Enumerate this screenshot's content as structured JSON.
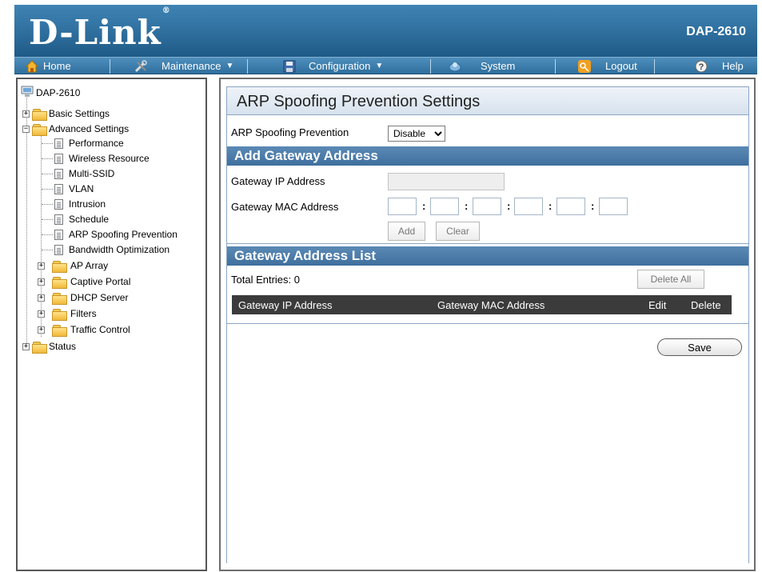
{
  "header": {
    "brand": "D-Link",
    "model": "DAP-2610"
  },
  "menu": {
    "home": "Home",
    "maintenance": "Maintenance",
    "configuration": "Configuration",
    "system": "System",
    "logout": "Logout",
    "help": "Help"
  },
  "tree": {
    "root": "DAP-2610",
    "basic_settings": "Basic Settings",
    "advanced_settings": "Advanced Settings",
    "advanced_items": [
      "Performance",
      "Wireless Resource",
      "Multi-SSID",
      "VLAN",
      "Intrusion",
      "Schedule",
      "ARP Spoofing Prevention",
      "Bandwidth Optimization"
    ],
    "advanced_folders": [
      "AP Array",
      "Captive Portal",
      "DHCP Server",
      "Filters",
      "Traffic Control"
    ],
    "status": "Status"
  },
  "main": {
    "title": "ARP Spoofing Prevention Settings",
    "arp_label": "ARP Spoofing Prevention",
    "arp_value": "Disable",
    "add_gateway": {
      "heading": "Add Gateway Address",
      "ip_label": "Gateway IP Address",
      "ip_value": "",
      "mac_label": "Gateway MAC Address",
      "mac_values": [
        "",
        "",
        "",
        "",
        "",
        ""
      ],
      "add_button": "Add",
      "clear_button": "Clear"
    },
    "gateway_list": {
      "heading": "Gateway Address List",
      "total_entries": "Total Entries: 0",
      "delete_all_button": "Delete All",
      "columns": [
        "Gateway IP Address",
        "Gateway MAC Address",
        "Edit",
        "Delete"
      ]
    },
    "save_button": "Save"
  }
}
